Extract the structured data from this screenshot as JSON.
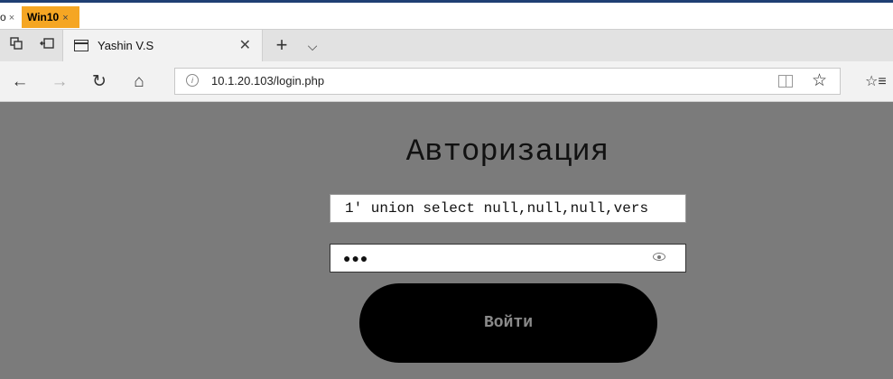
{
  "vm_tabs": [
    {
      "label": "o",
      "close": "×"
    },
    {
      "label": "Win10",
      "close": "×"
    }
  ],
  "browser": {
    "tab": {
      "title": "Yashin V.S",
      "close": "✕"
    },
    "new_tab": "+",
    "tab_list": "⌵",
    "nav": {
      "back": "←",
      "forward": "→",
      "refresh": "↻",
      "home": "⌂"
    },
    "address": {
      "url": "10.1.20.103/login.php",
      "info": "i",
      "favorite": "☆"
    },
    "favorites_hub": "☆≡"
  },
  "login": {
    "title": "Авторизация",
    "username_value": "1' union select null,null,null,vers",
    "password_dots": "●●●",
    "button_label": "Войти"
  },
  "colors": {
    "page_background": "#7b7b7b",
    "vm_tab_active": "#f5a623",
    "button_background": "#000000",
    "button_text": "#8a8a8a"
  }
}
